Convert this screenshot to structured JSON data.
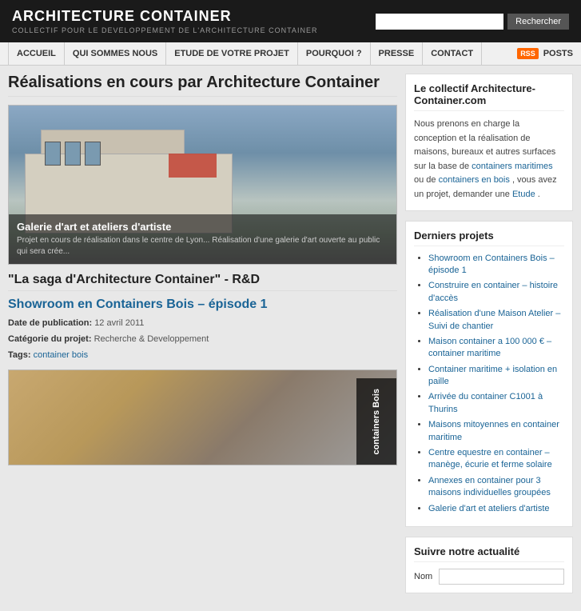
{
  "site": {
    "title": "ARCHITECTURE CONTAINER",
    "subtitle": "COLLECTIF POUR LE DEVELOPPEMENT DE L'ARCHITECTURE CONTAINER",
    "search_placeholder": "",
    "search_btn": "Rechercher"
  },
  "nav": {
    "links": [
      {
        "label": "ACCUEIL",
        "href": "#"
      },
      {
        "label": "QUI SOMMES NOUS",
        "href": "#"
      },
      {
        "label": "ETUDE DE VOTRE PROJET",
        "href": "#"
      },
      {
        "label": "POURQUOI ?",
        "href": "#"
      },
      {
        "label": "PRESSE",
        "href": "#"
      },
      {
        "label": "CONTACT",
        "href": "#"
      }
    ],
    "rss_label": "RSS",
    "posts_label": "POSTS"
  },
  "main": {
    "page_title": "Réalisations en cours par Architecture Container",
    "hero": {
      "caption": "Galerie d'art et ateliers d'artiste",
      "description": "Projet en cours de réalisation dans le centre de Lyon... Réalisation d'une galerie d'art ouverte au public qui sera crée..."
    },
    "section_title": "\"La saga d'Architecture Container\" - R&D",
    "article": {
      "title": "Showroom en Containers Bois – épisode 1",
      "date_label": "Date de publication:",
      "date_value": "12 avril 2011",
      "category_label": "Catégorie du projet:",
      "category_value": "Recherche & Developpement",
      "tags_label": "Tags:",
      "tag": "container bois",
      "img_label": "containers Bois"
    }
  },
  "sidebar": {
    "collectif_title": "Le collectif Architecture-Container.com",
    "collectif_text": "Nous prenons en charge la conception et la réalisation de maisons, bureaux et autres surfaces sur la base de",
    "link1": "containers maritimes",
    "text2": "ou de",
    "link2": "containers en bois",
    "text3": ", vous avez un projet, demander une",
    "link3": "Etude",
    "text4": ".",
    "derniers_title": "Derniers projets",
    "projects": [
      {
        "label": "Showroom en Containers Bois – épisode 1"
      },
      {
        "label": "Construire en container – histoire d'accès"
      },
      {
        "label": "Réalisation d'une Maison Atelier – Suivi de chantier"
      },
      {
        "label": "Maison container a 100 000 € – container maritime"
      },
      {
        "label": "Container maritime + isolation en paille"
      },
      {
        "label": "Arrivée du container C1001 à Thurins"
      },
      {
        "label": "Maisons mitoyennes en container maritime"
      },
      {
        "label": "Centre equestre en container – manège, écurie et ferme solaire"
      },
      {
        "label": "Annexes en container pour 3 maisons individuelles groupées"
      },
      {
        "label": "Galerie d'art et ateliers d'artiste"
      }
    ],
    "follow_title": "Suivre notre actualité",
    "follow_name_label": "Nom",
    "follow_email_placeholder": ""
  }
}
